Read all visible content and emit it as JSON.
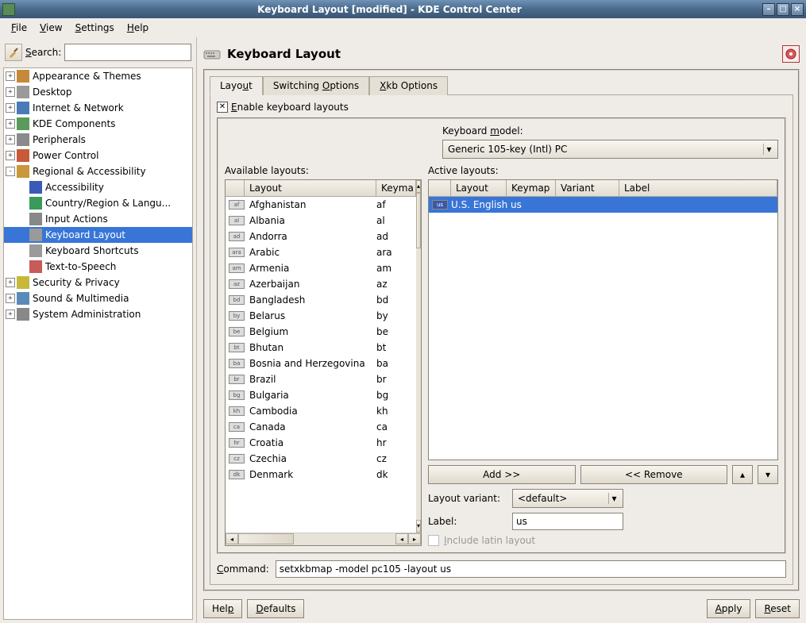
{
  "window": {
    "title": "Keyboard Layout [modified] - KDE Control Center"
  },
  "menubar": {
    "file": "File",
    "view": "View",
    "settings": "Settings",
    "help": "Help"
  },
  "sidebar": {
    "search_label": "Search:",
    "items": [
      {
        "exp": "+",
        "icon": "#c48a3a",
        "label": "Appearance & Themes"
      },
      {
        "exp": "+",
        "icon": "#9a9a9a",
        "label": "Desktop"
      },
      {
        "exp": "+",
        "icon": "#4a7ab8",
        "label": "Internet & Network"
      },
      {
        "exp": "+",
        "icon": "#5a9a5a",
        "label": "KDE Components"
      },
      {
        "exp": "+",
        "icon": "#8a8a8a",
        "label": "Peripherals"
      },
      {
        "exp": "+",
        "icon": "#c85a3a",
        "label": "Power Control"
      },
      {
        "exp": "-",
        "icon": "#c8983a",
        "label": "Regional & Accessibility"
      },
      {
        "exp": "",
        "depth": 1,
        "icon": "#3a5ab8",
        "label": "Accessibility"
      },
      {
        "exp": "",
        "depth": 1,
        "icon": "#3a9a5a",
        "label": "Country/Region & Langu..."
      },
      {
        "exp": "",
        "depth": 1,
        "icon": "#888888",
        "label": "Input Actions"
      },
      {
        "exp": "",
        "depth": 1,
        "icon": "#9a9a9a",
        "label": "Keyboard Layout",
        "sel": true
      },
      {
        "exp": "",
        "depth": 1,
        "icon": "#9a9a9a",
        "label": "Keyboard Shortcuts"
      },
      {
        "exp": "",
        "depth": 1,
        "icon": "#c85a5a",
        "label": "Text-to-Speech"
      },
      {
        "exp": "+",
        "icon": "#c8b83a",
        "label": "Security & Privacy"
      },
      {
        "exp": "+",
        "icon": "#5a8ab8",
        "label": "Sound & Multimedia"
      },
      {
        "exp": "+",
        "icon": "#888888",
        "label": "System Administration"
      }
    ]
  },
  "header": {
    "title": "Keyboard Layout"
  },
  "tabs": {
    "t0": "Layout",
    "t1": "Switching Options",
    "t2": "Xkb Options"
  },
  "enable_label": "Enable keyboard layouts",
  "km_label": "Keyboard model:",
  "km_value": "Generic 105-key (Intl) PC",
  "avail_label": "Available layouts:",
  "active_label": "Active layouts:",
  "col_layout": "Layout",
  "col_keymap": "Keymap",
  "col_variant": "Variant",
  "col_label": "Label",
  "avail": [
    {
      "f": "af",
      "n": "Afghanistan",
      "k": "af"
    },
    {
      "f": "al",
      "n": "Albania",
      "k": "al"
    },
    {
      "f": "ad",
      "n": "Andorra",
      "k": "ad"
    },
    {
      "f": "ara",
      "n": "Arabic",
      "k": "ara"
    },
    {
      "f": "am",
      "n": "Armenia",
      "k": "am"
    },
    {
      "f": "az",
      "n": "Azerbaijan",
      "k": "az"
    },
    {
      "f": "bd",
      "n": "Bangladesh",
      "k": "bd"
    },
    {
      "f": "by",
      "n": "Belarus",
      "k": "by"
    },
    {
      "f": "be",
      "n": "Belgium",
      "k": "be"
    },
    {
      "f": "bt",
      "n": "Bhutan",
      "k": "bt"
    },
    {
      "f": "ba",
      "n": "Bosnia and Herzegovina",
      "k": "ba"
    },
    {
      "f": "br",
      "n": "Brazil",
      "k": "br"
    },
    {
      "f": "bg",
      "n": "Bulgaria",
      "k": "bg"
    },
    {
      "f": "kh",
      "n": "Cambodia",
      "k": "kh"
    },
    {
      "f": "ca",
      "n": "Canada",
      "k": "ca"
    },
    {
      "f": "hr",
      "n": "Croatia",
      "k": "hr"
    },
    {
      "f": "cz",
      "n": "Czechia",
      "k": "cz"
    },
    {
      "f": "dk",
      "n": "Denmark",
      "k": "dk"
    }
  ],
  "active": [
    {
      "f": "us",
      "n": "U.S. English",
      "k": "us"
    }
  ],
  "btn_add": "Add >>",
  "btn_remove": "<< Remove",
  "variant_label": "Layout variant:",
  "variant_value": "<default>",
  "label_label": "Label:",
  "label_value": "us",
  "latin_label": "Include latin layout",
  "cmd_label": "Command:",
  "cmd_value": "setxkbmap -model pc105 -layout us",
  "footer": {
    "help": "Help",
    "defaults": "Defaults",
    "apply": "Apply",
    "reset": "Reset"
  }
}
